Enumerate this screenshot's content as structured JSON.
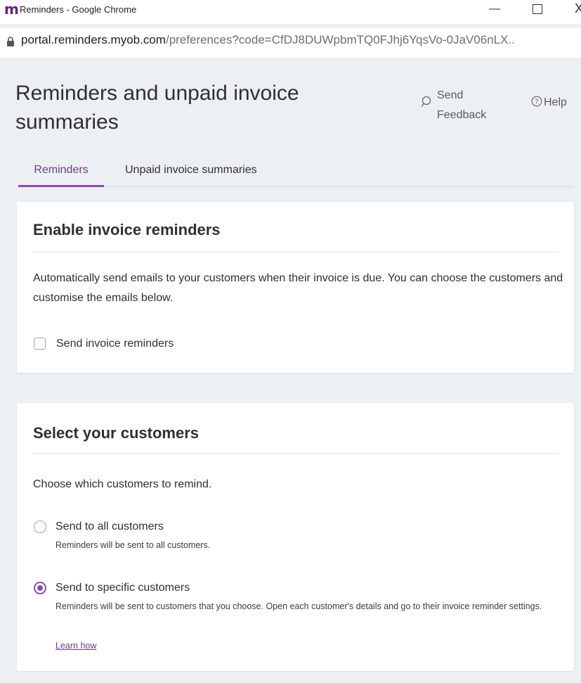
{
  "browser": {
    "app_logo": "m",
    "window_title": "Reminders - Google Chrome",
    "minimize": "—",
    "close": "X",
    "url_host": "portal.reminders.myob.com",
    "url_path": "/preferences?code=CfDJ8DUWpbmTQ0FJhj6YqsVo-0JaV06nLX..",
    "brand_color": "#6c1d82"
  },
  "header": {
    "title": "Reminders and unpaid invoice summaries",
    "feedback_label": "Send Feedback",
    "feedback_icon": "speech-bubble-icon",
    "help_label": "Help",
    "help_icon": "question-circle-icon"
  },
  "tabs": [
    {
      "label": "Reminders",
      "active": true
    },
    {
      "label": "Unpaid invoice summaries",
      "active": false
    }
  ],
  "enable_card": {
    "title": "Enable invoice reminders",
    "description": "Automatically send emails to your customers when their invoice is due. You can choose the customers and customise the emails below.",
    "checkbox_label": "Send invoice reminders",
    "checkbox_checked": false
  },
  "customers_card": {
    "title": "Select your customers",
    "description": "Choose which customers to remind.",
    "options": [
      {
        "label": "Send to all customers",
        "description": "Reminders will be sent to all customers.",
        "selected": false
      },
      {
        "label": "Send to specific customers",
        "description": "Reminders will be sent to customers that you choose. Open each customer's details and go to their invoice reminder settings.",
        "selected": true
      }
    ],
    "learn_how": "Learn how"
  },
  "colors": {
    "accent": "#8a4bb0",
    "background": "#edf0f3"
  }
}
